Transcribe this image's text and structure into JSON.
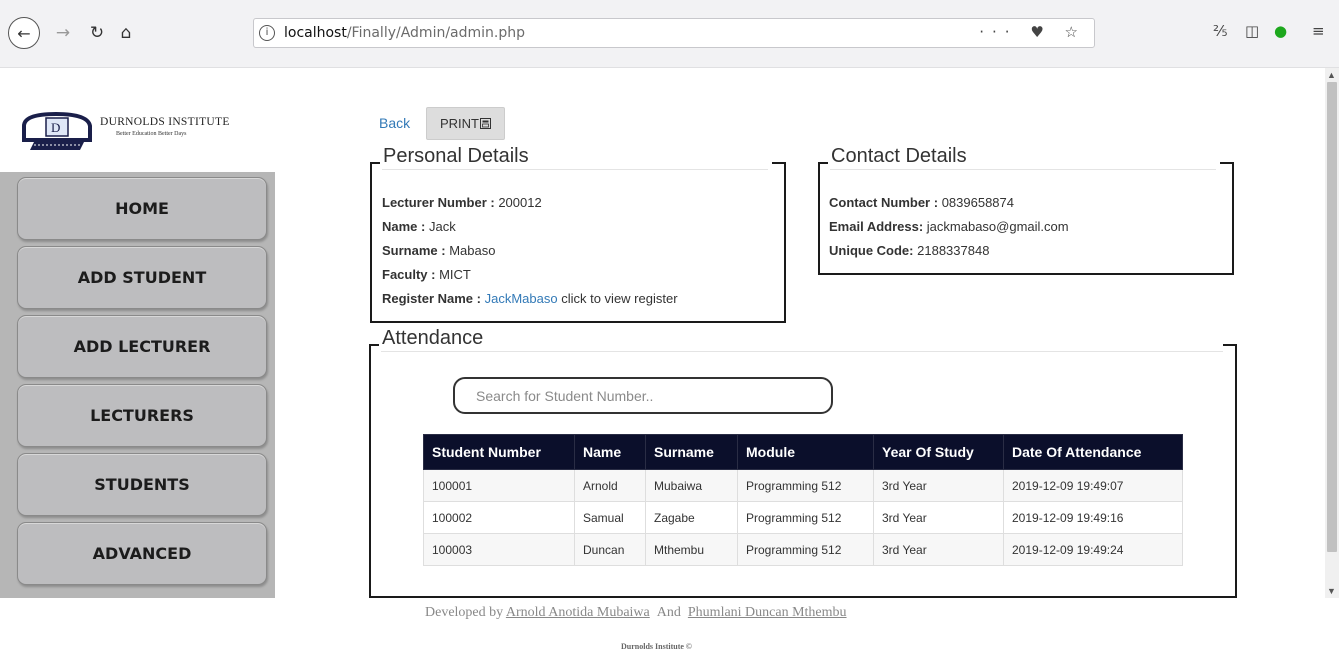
{
  "browser": {
    "url_host": "localhost",
    "url_path": "/Finally/Admin/admin.php",
    "info_icon": "i",
    "page_actions": "··· ♥ ☆"
  },
  "sidebar": {
    "logo_title": "DURNOLDS INSTITUTE",
    "logo_subtitle": "Better Education Better Days",
    "items": [
      {
        "label": "HOME"
      },
      {
        "label": "ADD STUDENT"
      },
      {
        "label": "ADD LECTURER"
      },
      {
        "label": "LECTURERS"
      },
      {
        "label": "STUDENTS"
      },
      {
        "label": "ADVANCED"
      }
    ]
  },
  "actions": {
    "back_label": "Back",
    "print_label": "PRINT"
  },
  "personal": {
    "legend": "Personal Details",
    "lecturer_number_label": "Lecturer Number :",
    "lecturer_number": "200012",
    "name_label": "Name :",
    "name": "Jack",
    "surname_label": "Surname :",
    "surname": "Mabaso",
    "faculty_label": "Faculty :",
    "faculty": "MICT",
    "register_label": "Register Name :",
    "register_link": "JackMabaso",
    "register_hint": "click to view register"
  },
  "contact": {
    "legend": "Contact Details",
    "contact_number_label": "Contact Number :",
    "contact_number": "0839658874",
    "email_label": "Email Address:",
    "email": "jackmabaso@gmail.com",
    "code_label": "Unique Code:",
    "code": "2188337848"
  },
  "attendance": {
    "legend": "Attendance",
    "search_placeholder": "Search for Student Number..",
    "columns": [
      "Student Number",
      "Name",
      "Surname",
      "Module",
      "Year Of Study",
      "Date Of Attendance"
    ],
    "rows": [
      [
        "100001",
        "Arnold",
        "Mubaiwa",
        "Programming 512",
        "3rd Year",
        "2019-12-09 19:49:07"
      ],
      [
        "100002",
        "Samual",
        "Zagabe",
        "Programming 512",
        "3rd Year",
        "2019-12-09 19:49:16"
      ],
      [
        "100003",
        "Duncan",
        "Mthembu",
        "Programming 512",
        "3rd Year",
        "2019-12-09 19:49:24"
      ]
    ]
  },
  "footer": {
    "developed_by": "Developed by",
    "dev1": "Arnold Anotida Mubaiwa",
    "and": "And",
    "dev2": "Phumlani Duncan Mthembu",
    "copyright": "Durnolds Institute  ©"
  }
}
